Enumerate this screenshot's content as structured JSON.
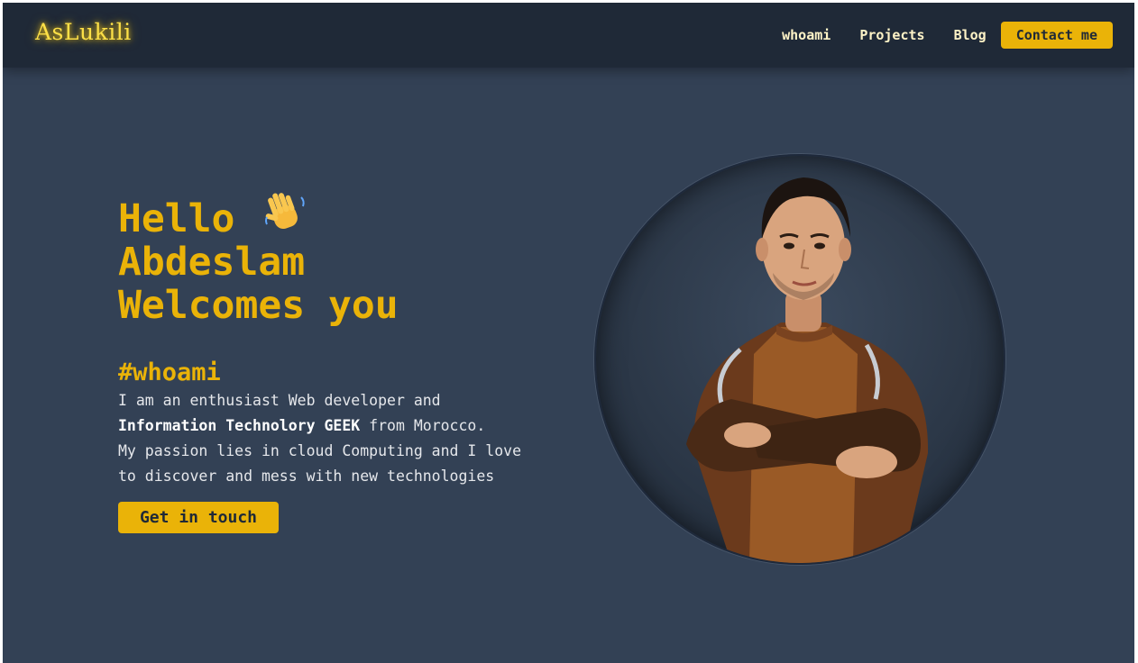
{
  "brand": "AsLukili",
  "nav": {
    "links": [
      "whoami",
      "Projects",
      "Blog"
    ],
    "contact": "Contact me"
  },
  "hero": {
    "title_lines": [
      "Hello",
      "Abdeslam",
      "Welcomes you"
    ],
    "wave_emoji": "👋",
    "tag": "#whoami",
    "bio": {
      "line1": "I am an enthusiast Web developer and",
      "line2_bold": "Information Technolory GEEK",
      "line2_rest": " from Morocco.",
      "line3": "My passion lies in cloud Computing and I love",
      "line4": "to discover and mess with new technologies"
    },
    "cta": "Get in touch"
  },
  "profile": {
    "image": "profile-photo"
  },
  "colors": {
    "accent": "#eab308",
    "navbar": "#1f2937",
    "background": "#334155",
    "text": "#e5e7eb"
  }
}
